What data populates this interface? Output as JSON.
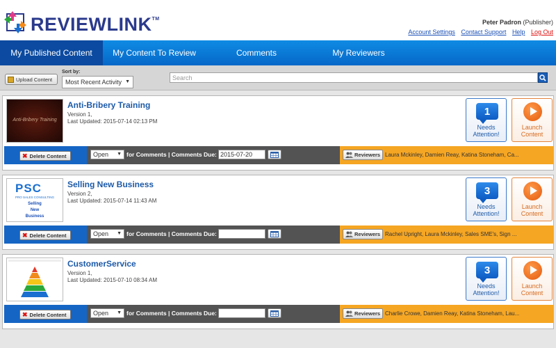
{
  "header": {
    "brand_text": "REVIEWLINK",
    "brand_tm": "TM",
    "user_name": "Peter Padron",
    "user_role": "(Publisher)",
    "links": [
      "Account Settings",
      "Contact Support",
      "Help",
      "Log Out"
    ]
  },
  "nav": {
    "tabs": [
      {
        "label": "My Published Content",
        "active": true
      },
      {
        "label": "My Content To Review",
        "active": false
      },
      {
        "label": "Comments",
        "active": false
      },
      {
        "label": "My Reviewers",
        "active": false
      }
    ]
  },
  "toolbar": {
    "upload_label": "Upload Content",
    "sort_label": "Sort by:",
    "sort_value": "Most Recent Activity",
    "search_placeholder": "Search"
  },
  "items": [
    {
      "title": "Anti-Bribery Training",
      "version": "Version 1,",
      "updated": "Last Updated: 2015-07-14 02:13 PM",
      "thumb_text": "Anti-Bribery Training",
      "attention_count": "1",
      "attention_label": "Needs Attention!",
      "launch_label": "Launch Content",
      "delete_label": "Delete Content",
      "status": "Open",
      "for_text": "for Comments  |  Comments Due:",
      "due_date": "2015-07-20",
      "reviewers_label": "Reviewers",
      "reviewer_names": "Laura Mckinley, Damien Reay, Katina Stoneham, Ca..."
    },
    {
      "title": "Selling New Business",
      "version": "Version 2,",
      "updated": "Last Updated: 2015-07-14 11:43 AM",
      "thumb_logo": "PSC",
      "thumb_company": "PRO SALES CONSULTING",
      "thumb_lines": [
        "Selling",
        "New",
        "Business"
      ],
      "attention_count": "3",
      "attention_label": "Needs Attention!",
      "launch_label": "Launch Content",
      "delete_label": "Delete Content",
      "status": "Open",
      "for_text": "for Comments  |  Comments Due:",
      "due_date": "",
      "reviewers_label": "Reviewers",
      "reviewer_names": "Rachel Upright, Laura Mckinley, Sales SME's, Sign ..."
    },
    {
      "title": "CustomerService",
      "version": "Version 1,",
      "updated": "Last Updated: 2015-07-10 08:34 AM",
      "attention_count": "3",
      "attention_label": "Needs Attention!",
      "launch_label": "Launch Content",
      "delete_label": "Delete Content",
      "status": "Open",
      "for_text": "for Comments  |  Comments Due:",
      "due_date": "",
      "reviewers_label": "Reviewers",
      "reviewer_names": "Charlie Crowe, Damien Reay, Katina Stoneham, Lau..."
    }
  ]
}
